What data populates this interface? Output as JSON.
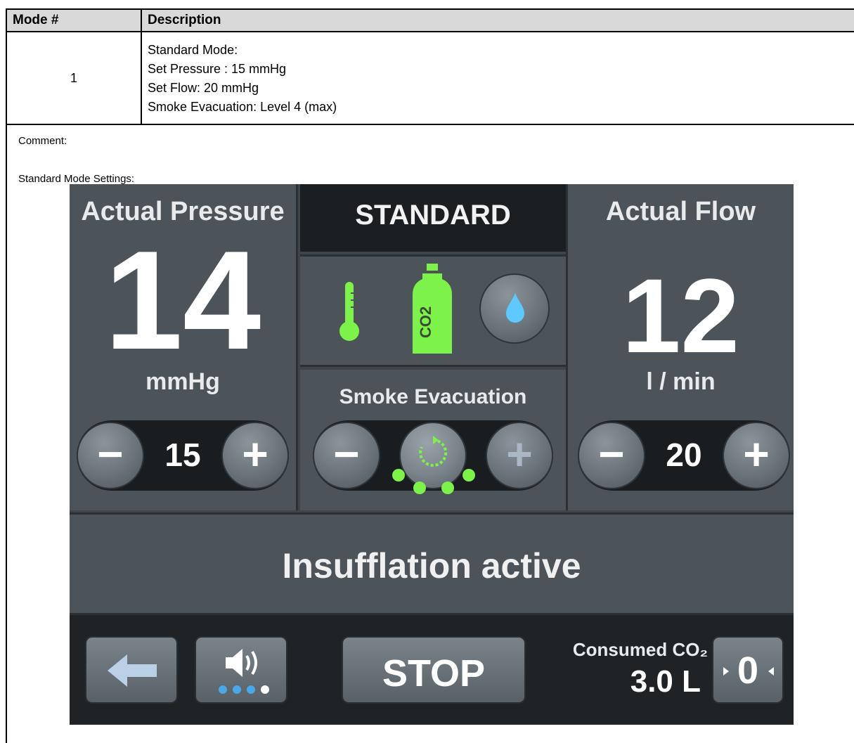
{
  "table": {
    "headers": [
      "Mode #",
      "Description"
    ],
    "row": {
      "mode_number": "1",
      "description": [
        "Standard Mode:",
        "Set Pressure : 15 mmHg",
        "Set Flow: 20 mmHg",
        "Smoke Evacuation: Level 4 (max)"
      ]
    },
    "comment_label": "Comment:",
    "settings_label": "Standard Mode Settings:"
  },
  "device": {
    "mode_title": "STANDARD",
    "pressure": {
      "label": "Actual Pressure",
      "value": "14",
      "unit": "mmHg",
      "setpoint": "15",
      "minus_symbol": "−",
      "plus_symbol": "+"
    },
    "flow": {
      "label": "Actual Flow",
      "value": "12",
      "unit": "l / min",
      "setpoint": "20",
      "minus_symbol": "−",
      "plus_symbol": "+"
    },
    "icons": {
      "thermometer": "thermometer-icon",
      "co2_bottle_text": "CO2",
      "humidifier": "water-drop-icon"
    },
    "smoke_evacuation": {
      "label": "Smoke Evacuation",
      "level": 4,
      "max_level": 4,
      "minus_symbol": "−",
      "plus_symbol": "+"
    },
    "status": "Insufflation active",
    "bottom": {
      "stop_label": "STOP",
      "volume_level": 3,
      "volume_max": 4,
      "consumed_label": "Consumed CO₂",
      "consumed_value": "3.0 L",
      "reset_label": "0"
    },
    "colors": {
      "accent_green": "#7cf24a",
      "screen_bg": "#3e4449",
      "panel": "#4c545a",
      "volume_blue": "#4aa8e8"
    }
  }
}
